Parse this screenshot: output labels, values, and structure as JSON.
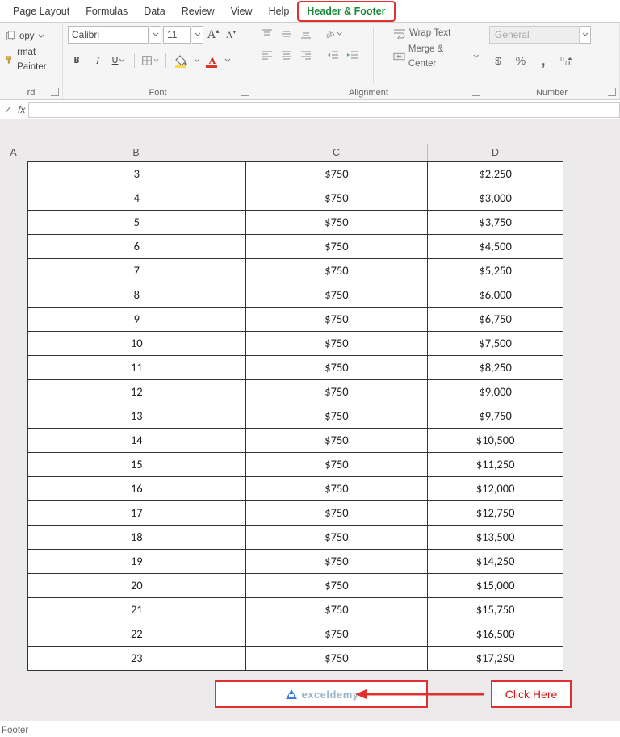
{
  "tabs": {
    "pageLayout": "Page Layout",
    "formulas": "Formulas",
    "data": "Data",
    "review": "Review",
    "view": "View",
    "help": "Help",
    "headerFooter": "Header & Footer"
  },
  "clipboard": {
    "copy": "opy",
    "formatPainter": "rmat Painter",
    "groupLabel": "rd"
  },
  "font": {
    "name": "Calibri",
    "size": "11",
    "bold": "B",
    "italic": "I",
    "underline": "U",
    "incA": "A",
    "decA": "A",
    "groupLabel": "Font"
  },
  "alignment": {
    "wrapText": "Wrap Text",
    "mergeCenter": "Merge & Center",
    "groupLabel": "Alignment"
  },
  "number": {
    "format": "General",
    "dollar": "$",
    "percent": "%",
    "comma": ",",
    "decInc": ".0",
    "groupLabel": "Number"
  },
  "formulaBar": {
    "check": "✓",
    "fx": "fx"
  },
  "columns": {
    "a": "A",
    "b": "B",
    "c": "C",
    "d": "D"
  },
  "rows": [
    {
      "b": "3",
      "c": "$750",
      "d": "$2,250"
    },
    {
      "b": "4",
      "c": "$750",
      "d": "$3,000"
    },
    {
      "b": "5",
      "c": "$750",
      "d": "$3,750"
    },
    {
      "b": "6",
      "c": "$750",
      "d": "$4,500"
    },
    {
      "b": "7",
      "c": "$750",
      "d": "$5,250"
    },
    {
      "b": "8",
      "c": "$750",
      "d": "$6,000"
    },
    {
      "b": "9",
      "c": "$750",
      "d": "$6,750"
    },
    {
      "b": "10",
      "c": "$750",
      "d": "$7,500"
    },
    {
      "b": "11",
      "c": "$750",
      "d": "$8,250"
    },
    {
      "b": "12",
      "c": "$750",
      "d": "$9,000"
    },
    {
      "b": "13",
      "c": "$750",
      "d": "$9,750"
    },
    {
      "b": "14",
      "c": "$750",
      "d": "$10,500"
    },
    {
      "b": "15",
      "c": "$750",
      "d": "$11,250"
    },
    {
      "b": "16",
      "c": "$750",
      "d": "$12,000"
    },
    {
      "b": "17",
      "c": "$750",
      "d": "$12,750"
    },
    {
      "b": "18",
      "c": "$750",
      "d": "$13,500"
    },
    {
      "b": "19",
      "c": "$750",
      "d": "$14,250"
    },
    {
      "b": "20",
      "c": "$750",
      "d": "$15,000"
    },
    {
      "b": "21",
      "c": "$750",
      "d": "$15,750"
    },
    {
      "b": "22",
      "c": "$750",
      "d": "$16,500"
    },
    {
      "b": "23",
      "c": "$750",
      "d": "$17,250"
    }
  ],
  "footer": {
    "logo": "exceldemy",
    "clickHere": "Click Here",
    "label": "Footer"
  }
}
